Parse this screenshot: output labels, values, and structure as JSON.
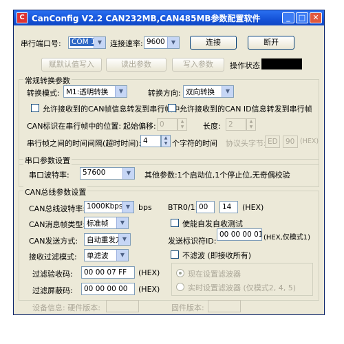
{
  "window": {
    "title": "CanConfig  V2.2     CAN232MB,CAN485MB参数配置软件",
    "icon_text": "C"
  },
  "serial": {
    "port_label": "串行端口号:",
    "port_value": "COM 1",
    "baud_label": "连接速率:",
    "baud_value": "9600",
    "connect": "连接",
    "disconnect": "断开"
  },
  "toolbar": {
    "write_default": "赋默认值写入",
    "read_params": "读出参数",
    "write_params": "写入参数",
    "status_label": "操作状态"
  },
  "conventional": {
    "title": "常规转换参数",
    "mode_label": "转换模式:",
    "mode_value": "M1:透明转换",
    "direction_label": "转换方向:",
    "direction_value": "双向转换",
    "chk_can_to_serial": "允许接收到的CAN帧信息转发到串行帧中",
    "chk_canid_to_serial": "允许接收到的CAN ID信息转发到串行帧",
    "can_pos_label": "CAN标识在串行帧中的位置:",
    "offset_label": "起始偏移:",
    "offset_value": "0",
    "length_label": "长度:",
    "length_value": "2",
    "interval_label": "串行帧之间的时间间隔(超时时间):",
    "interval_value": "4",
    "interval_unit": "个字符的时间",
    "header_label": "协议头字节:",
    "header_1": "ED",
    "header_2": "90",
    "header_unit": "(HEX)"
  },
  "serial_params": {
    "title": "串口参数设置",
    "baud_label": "串口波特率:",
    "baud_value": "57600",
    "other_info": "其他参数:1个启动位,1个停止位,无奇偶校验"
  },
  "can_params": {
    "title": "CAN总线参数设置",
    "bus_baud_label": "CAN总线波特率:",
    "bus_baud_value": "1000Kbps",
    "bus_baud_unit": "bps",
    "btr_label": "BTR0/1:",
    "btr0": "00",
    "btr1": "14",
    "btr_unit": "(HEX)",
    "frame_type_label": "CAN消息帧类型:",
    "frame_type_value": "标准帧",
    "self_test": "使能自发自收测试",
    "send_mode_label": "CAN发送方式:",
    "send_mode_value": "自动重发方式",
    "send_id_label": "发送标识符ID:",
    "send_id_value": "00 00 00 01",
    "send_id_unit": "(HEX,仅模式1)",
    "filter_mode_label": "接收过滤模式:",
    "filter_mode_value": "单滤波",
    "no_filter": "不滤波 (即接收所有)",
    "filter_code_label": "过滤验收码:",
    "filter_code_value": "00 00 07 FF",
    "filter_code_unit": "(HEX)",
    "filter_mask_label": "过滤屏蔽码:",
    "filter_mask_value": "00 00 00 00",
    "filter_mask_unit": "(HEX)",
    "radio_now": "现在设置滤波器",
    "radio_realtime": "实时设置滤波器 (仅模式2, 4, 5)"
  },
  "device_info": {
    "hw_label": "设备信息: 硬件版本:",
    "fw_label": "固件版本:"
  }
}
